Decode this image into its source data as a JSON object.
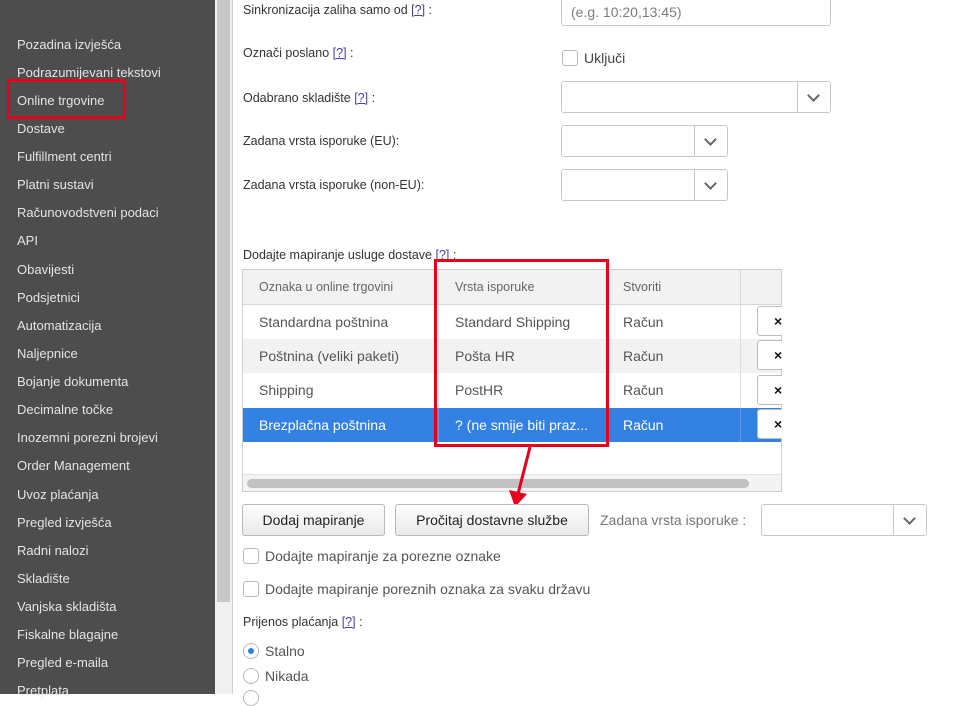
{
  "sidebar": {
    "items": [
      {
        "label": "Pozadina izvješća"
      },
      {
        "label": "Podrazumijevani tekstovi"
      },
      {
        "label": "Online trgovine"
      },
      {
        "label": "Dostave"
      },
      {
        "label": "Fulfillment centri"
      },
      {
        "label": "Platni sustavi"
      },
      {
        "label": "Računovodstveni podaci"
      },
      {
        "label": "API"
      },
      {
        "label": "Obavijesti"
      },
      {
        "label": "Podsjetnici"
      },
      {
        "label": "Automatizacija"
      },
      {
        "label": "Naljepnice"
      },
      {
        "label": "Bojanje dokumenta"
      },
      {
        "label": "Decimalne točke"
      },
      {
        "label": "Inozemni porezni brojevi"
      },
      {
        "label": "Order Management"
      },
      {
        "label": "Uvoz plaćanja"
      },
      {
        "label": "Pregled izvješća"
      },
      {
        "label": "Radni nalozi"
      },
      {
        "label": "Skladište"
      },
      {
        "label": "Vanjska skladišta"
      },
      {
        "label": "Fiskalne blagajne"
      },
      {
        "label": "Pregled e-maila"
      },
      {
        "label": "Pretplata"
      }
    ]
  },
  "help_marker": "[?]",
  "form": {
    "sync_label": "Sinkronizacija zaliha samo od",
    "sync_placeholder": "(e.g. 10:20,13:45)",
    "mark_sent_label": "Označi poslano",
    "mark_sent_option": "Uključi",
    "warehouse_label": "Odabrano skladište",
    "delivery_eu_label": "Zadana vrsta isporuke (EU):",
    "delivery_noneu_label": "Zadana vrsta isporuke (non-EU):",
    "mapping_label": "Dodajte mapiranje usluge dostave",
    "colon": ":"
  },
  "mapping_table": {
    "columns": [
      "Oznaka u online trgovini",
      "Vrsta isporuke",
      "Stvoriti"
    ],
    "rows": [
      {
        "shop_label": "Standardna poštnina",
        "delivery_type": "Standard Shipping",
        "create": "Račun",
        "remove": "×"
      },
      {
        "shop_label": "Poštnina (veliki paketi)",
        "delivery_type": "Pošta HR",
        "create": "Račun",
        "remove": "×"
      },
      {
        "shop_label": "Shipping",
        "delivery_type": "PostHR",
        "create": "Račun",
        "remove": "×"
      },
      {
        "shop_label": "Brezplačna poštnina",
        "delivery_type": "? (ne smije biti praz...",
        "create": "Račun",
        "remove": "×"
      }
    ],
    "selected_row": 3
  },
  "actions": {
    "add_mapping": "Dodaj mapiranje",
    "read_services": "Pročitaj dostavne službe",
    "default_delivery_label": "Zadana vrsta isporuke :"
  },
  "options": {
    "tax_mapping": "Dodajte mapiranje za porezne oznake",
    "tax_mapping_country": "Dodajte mapiranje poreznih oznaka za svaku državu"
  },
  "payment_transfer": {
    "label": "Prijenos plaćanja",
    "choices": [
      "Stalno",
      "Nikada"
    ],
    "selected": "Stalno"
  },
  "colors": {
    "sidebar_bg": "#4d4d4d",
    "highlight_red": "#e8001c",
    "selected_row": "#3381e3"
  }
}
